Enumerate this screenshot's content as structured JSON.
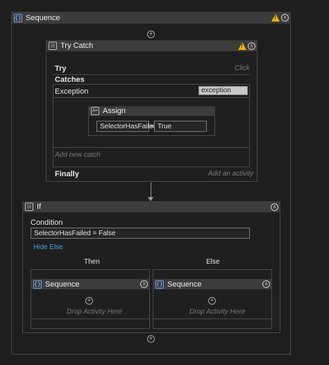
{
  "sequence": {
    "title": "Sequence",
    "icon": "sequence-icon",
    "warning_icon": "warning-icon",
    "collapse_icon": "collapse-icon"
  },
  "try_catch": {
    "title": "Try Catch",
    "try_label": "Try",
    "try_hint": "Click",
    "catches_label": "Catches",
    "exception_label": "Exception",
    "exception_var": "exception",
    "assign": {
      "title": "Assign",
      "to": "SelectorHasFailed",
      "operator": "=",
      "value": "True"
    },
    "add_catch_hint": "Add new catch",
    "finally_label": "Finally",
    "finally_hint": "Add an activity"
  },
  "if_activity": {
    "title": "If",
    "condition_label": "Condition",
    "condition_value": "SelectorHasFailed = False",
    "hide_else": "Hide Else",
    "then_label": "Then",
    "else_label": "Else",
    "then_sequence": {
      "title": "Sequence",
      "drop_hint": "Drop Activity Here"
    },
    "else_sequence": {
      "title": "Sequence",
      "drop_hint": "Drop Activity Here"
    }
  },
  "colors": {
    "background": "#1e1e1e",
    "header": "#3c3c3c",
    "accent_blue": "#4aa0e0",
    "warning": "#f0b400"
  }
}
